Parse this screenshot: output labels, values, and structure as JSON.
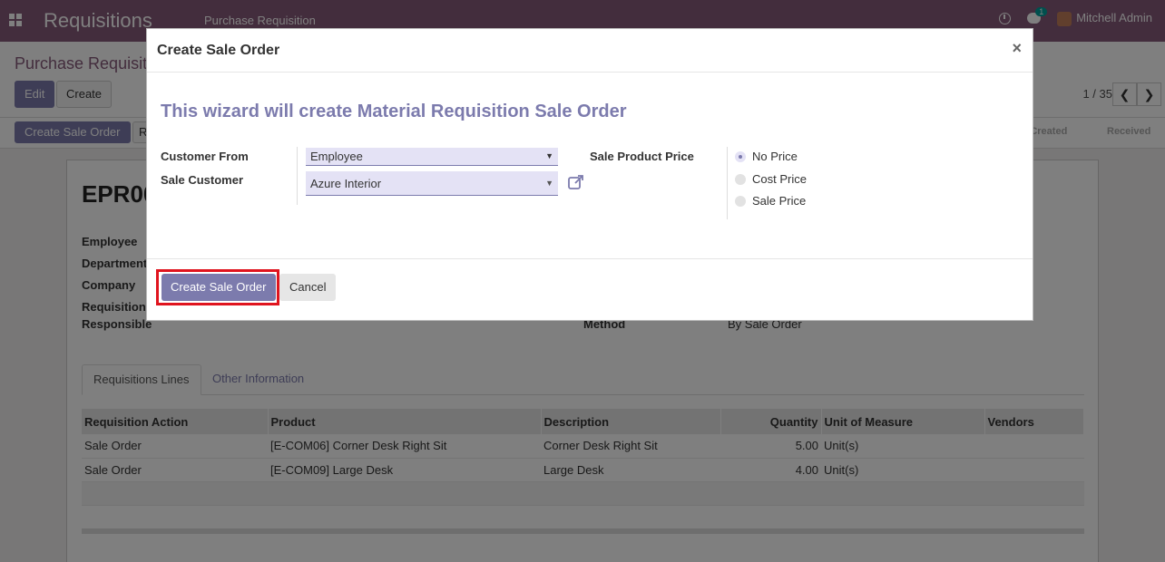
{
  "navbar": {
    "app_name": "Requisitions",
    "menu_item": "Purchase Requisition",
    "chat_badge": "1",
    "user_name": "Mitchell Admin"
  },
  "control_panel": {
    "breadcrumb": "Purchase Requisit",
    "edit_label": "Edit",
    "create_label": "Create",
    "pager": "1 / 35",
    "pager_prev": "❮",
    "pager_next": "❯"
  },
  "statusbar": {
    "create_sale_order_label": "Create Sale Order",
    "second_button_label": "R",
    "stage_partial": "r Created",
    "stage_received": "Received"
  },
  "sheet": {
    "ref_partial": "EPR00",
    "labels": {
      "employee": "Employee",
      "department": "Department",
      "company": "Company",
      "requisition": "Requisition",
      "responsible": "Responsible",
      "method": "Method"
    },
    "method_value": "By Sale Order",
    "tabs": [
      "Requisitions Lines",
      "Other Information"
    ],
    "lines": {
      "columns": [
        "Requisition Action",
        "Product",
        "Description",
        "Quantity",
        "Unit of Measure",
        "Vendors"
      ],
      "rows": [
        [
          "Sale Order",
          "[E-COM06] Corner Desk Right Sit",
          "Corner Desk Right Sit",
          "5.00",
          "Unit(s)",
          ""
        ],
        [
          "Sale Order",
          "[E-COM09] Large Desk",
          "Large Desk",
          "4.00",
          "Unit(s)",
          ""
        ]
      ]
    }
  },
  "modal": {
    "title": "Create Sale Order",
    "close_glyph": "×",
    "heading": "This wizard will create Material Requisition Sale Order",
    "customer_from_label": "Customer From",
    "customer_from_value": "Employee",
    "sale_customer_label": "Sale Customer",
    "sale_customer_value": "Azure Interior",
    "sale_product_price_label": "Sale Product Price",
    "price_options": [
      "No Price",
      "Cost Price",
      "Sale Price"
    ],
    "selected_price_option": "No Price",
    "create_button": "Create Sale Order",
    "cancel_button": "Cancel"
  },
  "colors": {
    "brand": "#875a7b",
    "primary": "#7c7bad",
    "highlight": "#e0141e"
  }
}
